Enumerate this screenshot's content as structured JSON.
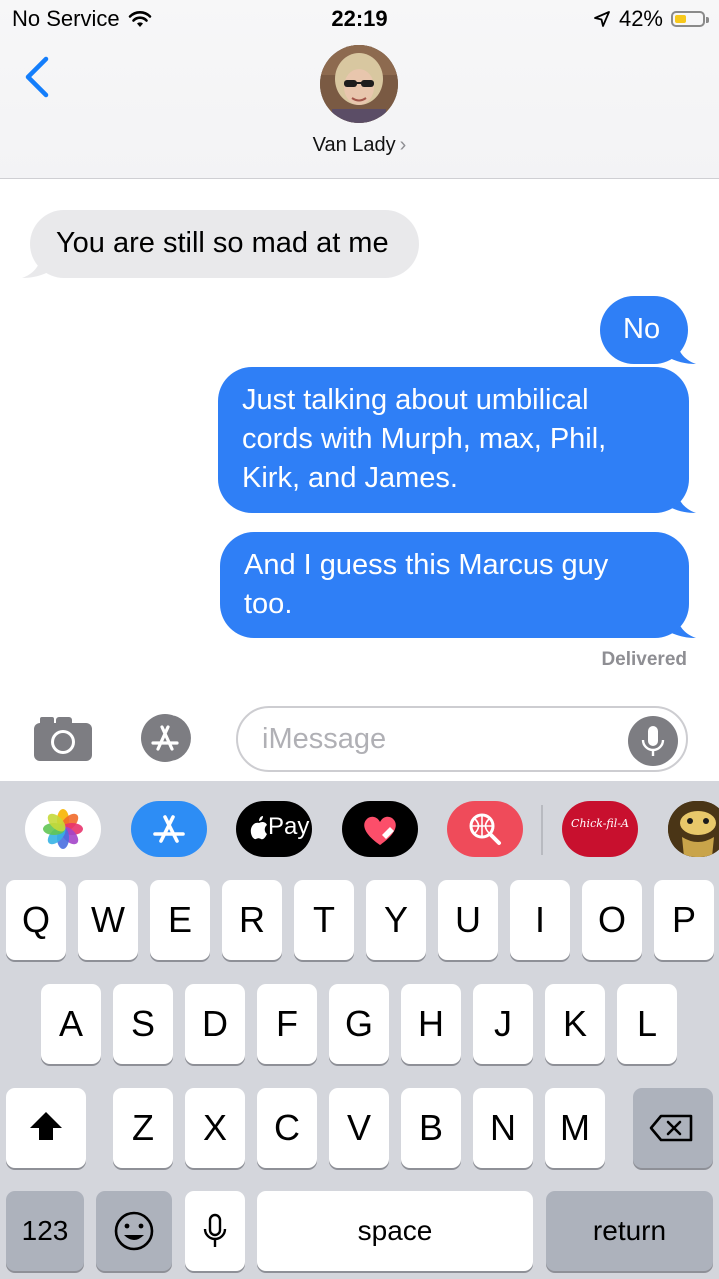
{
  "status_bar": {
    "carrier": "No Service",
    "time": "22:19",
    "battery_percent": "42%",
    "battery_level": 0.42
  },
  "header": {
    "contact_name": "Van Lady",
    "contact_chevron": "›",
    "back_icon": "chevron-left-icon"
  },
  "messages": [
    {
      "direction": "received",
      "text": "You are still so mad at me"
    },
    {
      "direction": "sent",
      "text": "No"
    },
    {
      "direction": "sent",
      "lines": [
        "Just talking about umbilical",
        "cords with Murph, max, Phil,",
        "Kirk, and James."
      ]
    },
    {
      "direction": "sent",
      "lines": [
        "And I guess this Marcus guy",
        "too."
      ]
    }
  ],
  "delivered_label": "Delivered",
  "input": {
    "placeholder": "iMessage"
  },
  "app_strip": {
    "apple_pay_label": "Pay",
    "chickfila_label": "Chick-fil-A"
  },
  "keyboard": {
    "row1": [
      "Q",
      "W",
      "E",
      "R",
      "T",
      "Y",
      "U",
      "I",
      "O",
      "P"
    ],
    "row2": [
      "A",
      "S",
      "D",
      "F",
      "G",
      "H",
      "J",
      "K",
      "L"
    ],
    "row3": [
      "Z",
      "X",
      "C",
      "V",
      "B",
      "N",
      "M"
    ],
    "numbers_label": "123",
    "space_label": "space",
    "return_label": "return"
  },
  "colors": {
    "sent_bubble": "#2f7ff6",
    "received_bubble": "#e9e9eb",
    "ios_blue": "#147efb",
    "keyboard_bg": "#d4d6dc"
  }
}
